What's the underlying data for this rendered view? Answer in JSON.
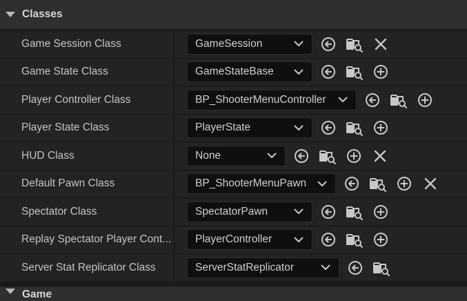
{
  "sections": {
    "classes": "Classes",
    "game": "Game"
  },
  "rows": [
    {
      "label": "Game Session Class",
      "value": "GameSession",
      "buttons": [
        "use-selected",
        "browse",
        "clear"
      ]
    },
    {
      "label": "Game State Class",
      "value": "GameStateBase",
      "buttons": [
        "use-selected",
        "browse",
        "add"
      ]
    },
    {
      "label": "Player Controller Class",
      "value": "BP_ShooterMenuController",
      "buttons": [
        "use-selected",
        "browse",
        "add"
      ]
    },
    {
      "label": "Player State Class",
      "value": "PlayerState",
      "buttons": [
        "use-selected",
        "browse",
        "add"
      ]
    },
    {
      "label": "HUD Class",
      "value": "None",
      "buttons": [
        "use-selected",
        "browse",
        "add",
        "clear"
      ]
    },
    {
      "label": "Default Pawn Class",
      "value": "BP_ShooterMenuPawn",
      "buttons": [
        "use-selected",
        "browse",
        "add",
        "clear"
      ]
    },
    {
      "label": "Spectator Class",
      "value": "SpectatorPawn",
      "buttons": [
        "use-selected",
        "browse",
        "add"
      ]
    },
    {
      "label": "Replay Spectator Player Cont...",
      "value": "PlayerController",
      "buttons": [
        "use-selected",
        "browse",
        "add"
      ]
    },
    {
      "label": "Server Stat Replicator Class",
      "value": "ServerStatReplicator",
      "buttons": [
        "use-selected",
        "browse"
      ]
    }
  ],
  "icons": {
    "use-selected": "arrow-left-circle-icon",
    "browse": "folder-search-icon",
    "add": "plus-circle-icon",
    "clear": "close-icon",
    "chevron": "chevron-down-icon",
    "collapse": "triangle-down-icon"
  },
  "colors": {
    "background": "#1a1a1a",
    "section_header": "#2f2f2f",
    "row": "#232323",
    "combo": "#0f0f0f",
    "icon": "#c8c8c8"
  }
}
